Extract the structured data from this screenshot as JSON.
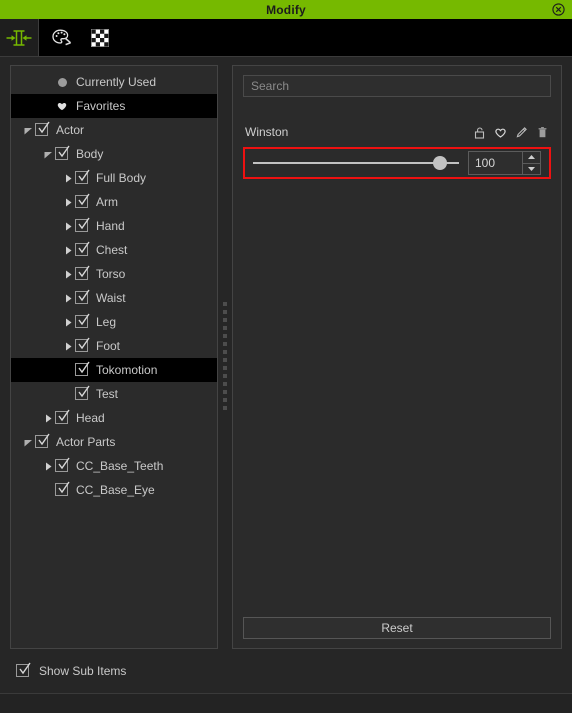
{
  "window": {
    "title": "Modify",
    "close_icon": "close-circle-icon",
    "accent_color": "#76b900",
    "background_color": "#262626"
  },
  "toolbar": {
    "items": [
      {
        "icon": "modify-scale-icon",
        "active": true
      },
      {
        "icon": "palette-brush-icon",
        "active": false
      },
      {
        "icon": "checkerboard-opacity-icon",
        "active": false
      }
    ]
  },
  "tree": {
    "rows": [
      {
        "label": "Currently Used",
        "indent": 1,
        "lead": "circle-icon",
        "arrow": "none",
        "checkbox": false,
        "selected": false
      },
      {
        "label": "Favorites",
        "indent": 1,
        "lead": "heart-icon",
        "arrow": "none",
        "checkbox": false,
        "selected": true
      },
      {
        "label": "Actor",
        "indent": 0,
        "lead": "none",
        "arrow": "expanded",
        "checkbox": true,
        "selected": false
      },
      {
        "label": "Body",
        "indent": 1,
        "lead": "none",
        "arrow": "expanded",
        "checkbox": true,
        "selected": false
      },
      {
        "label": "Full Body",
        "indent": 2,
        "lead": "none",
        "arrow": "collapsed",
        "checkbox": true,
        "selected": false
      },
      {
        "label": "Arm",
        "indent": 2,
        "lead": "none",
        "arrow": "collapsed",
        "checkbox": true,
        "selected": false
      },
      {
        "label": "Hand",
        "indent": 2,
        "lead": "none",
        "arrow": "collapsed",
        "checkbox": true,
        "selected": false
      },
      {
        "label": "Chest",
        "indent": 2,
        "lead": "none",
        "arrow": "collapsed",
        "checkbox": true,
        "selected": false
      },
      {
        "label": "Torso",
        "indent": 2,
        "lead": "none",
        "arrow": "collapsed",
        "checkbox": true,
        "selected": false
      },
      {
        "label": "Waist",
        "indent": 2,
        "lead": "none",
        "arrow": "collapsed",
        "checkbox": true,
        "selected": false
      },
      {
        "label": "Leg",
        "indent": 2,
        "lead": "none",
        "arrow": "collapsed",
        "checkbox": true,
        "selected": false
      },
      {
        "label": "Foot",
        "indent": 2,
        "lead": "none",
        "arrow": "collapsed",
        "checkbox": true,
        "selected": false
      },
      {
        "label": "Tokomotion",
        "indent": 2,
        "lead": "none",
        "arrow": "none",
        "checkbox": true,
        "selected": true
      },
      {
        "label": "Test",
        "indent": 2,
        "lead": "none",
        "arrow": "none",
        "checkbox": true,
        "selected": false
      },
      {
        "label": "Head",
        "indent": 1,
        "lead": "none",
        "arrow": "collapsed",
        "checkbox": true,
        "selected": false
      },
      {
        "label": "Actor Parts",
        "indent": 0,
        "lead": "none",
        "arrow": "expanded",
        "checkbox": true,
        "selected": false
      },
      {
        "label": "CC_Base_Teeth",
        "indent": 1,
        "lead": "none",
        "arrow": "collapsed",
        "checkbox": true,
        "selected": false
      },
      {
        "label": "CC_Base_Eye",
        "indent": 1,
        "lead": "none",
        "arrow": "none",
        "checkbox": true,
        "selected": false
      }
    ]
  },
  "splitter": {
    "name": "panel-splitter"
  },
  "right_panel": {
    "search": {
      "value": "",
      "placeholder": "Search",
      "name": "search-input"
    },
    "parameter": {
      "name": "Winston",
      "actions": [
        {
          "icon": "unlock-icon",
          "title": "Lock"
        },
        {
          "icon": "heart-icon",
          "title": "Favorite"
        },
        {
          "icon": "pencil-icon",
          "title": "Edit"
        },
        {
          "icon": "trash-icon",
          "title": "Delete"
        }
      ],
      "slider": {
        "value": 100,
        "min": 0,
        "max": 110,
        "percent": 91,
        "highlight_color": "#ee1111"
      },
      "spinner": {
        "value": "100",
        "up_icon": "triangle-up-icon",
        "down_icon": "triangle-down-icon"
      }
    },
    "reset_label": "Reset"
  },
  "footer": {
    "show_sub_items": {
      "label": "Show Sub Items",
      "checked": true
    }
  }
}
